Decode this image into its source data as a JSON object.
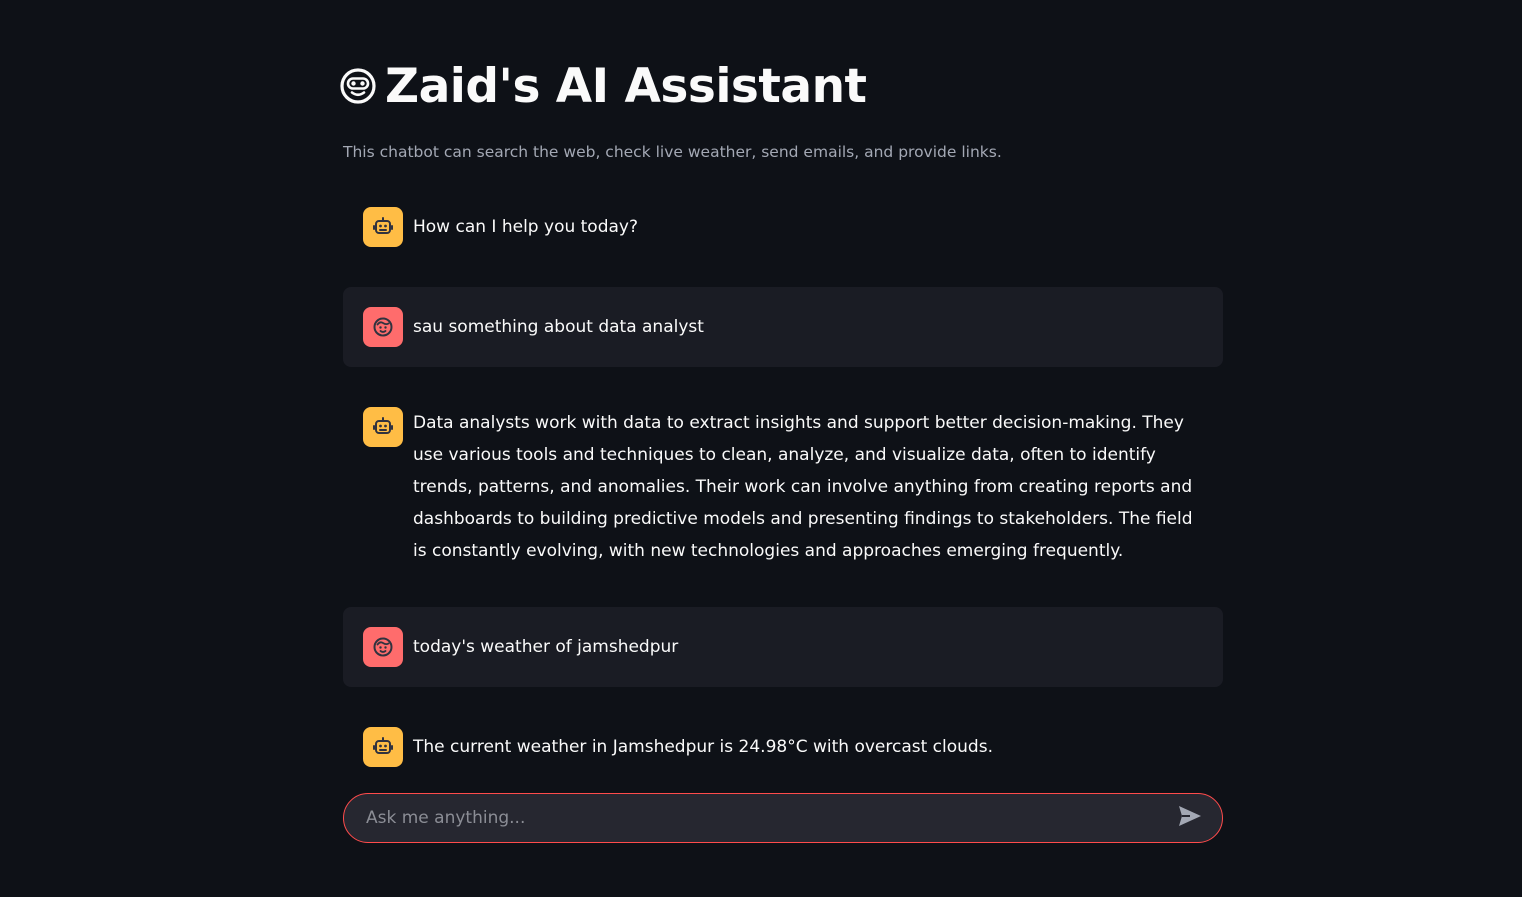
{
  "header": {
    "title": "Zaid's AI Assistant",
    "icon": "robot-face-icon",
    "subtitle": "This chatbot can search the web, check live weather, send emails, and provide links."
  },
  "messages": [
    {
      "role": "assistant",
      "avatar": "bot-icon",
      "text": "How can I help you today?"
    },
    {
      "role": "user",
      "avatar": "user-face-icon",
      "text": "sau something about data analyst"
    },
    {
      "role": "assistant",
      "avatar": "bot-icon",
      "text": "Data analysts work with data to extract insights and support better decision-making. They use various tools and techniques to clean, analyze, and visualize data, often to identify trends, patterns, and anomalies. Their work can involve anything from creating reports and dashboards to building predictive models and presenting findings to stakeholders. The field is constantly evolving, with new technologies and approaches emerging frequently."
    },
    {
      "role": "user",
      "avatar": "user-face-icon",
      "text": "today's weather of jamshedpur"
    },
    {
      "role": "assistant",
      "avatar": "bot-icon",
      "text": "The current weather in Jamshedpur is 24.98°C with overcast clouds."
    }
  ],
  "chat_input": {
    "placeholder": "Ask me anything...",
    "value": "",
    "send_icon": "send-icon"
  },
  "colors": {
    "background": "#0e1117",
    "user_bubble": "#1a1c24",
    "bot_avatar": "#ffbd45",
    "user_avatar": "#ff6c6c",
    "input_border": "#ff4b4b",
    "input_bg": "#262730"
  }
}
